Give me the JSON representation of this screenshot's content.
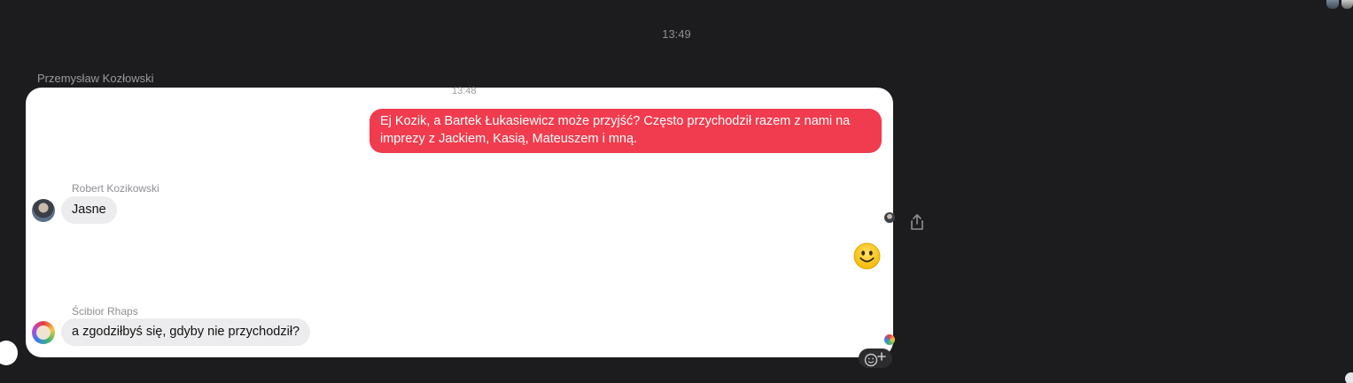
{
  "chat": {
    "top_timestamp": "13:49",
    "group_sender": "Przemysław Kozłowski",
    "group_timestamp": "13:48",
    "outgoing_message": "Ej Kozik, a Bartek Łukasiewicz może przyjść? Często przychodził razem z nami na imprezy z Jackiem, Kasią, Mateuszem i mną.",
    "messages": [
      {
        "sender": "Robert Kozikowski",
        "text": "Jasne",
        "avatar_icon": "avatar-robert"
      },
      {
        "sender": "Ścibior Rhaps",
        "text": "a zgodziłbyś się, gdyby nie przychodził?",
        "avatar_icon": "avatar-scibior"
      }
    ],
    "reaction_emoji": "smiley-face-emoji",
    "react_button_icon": "add-reaction-icon",
    "share_icon": "share-icon"
  },
  "colors": {
    "background": "#1c1c1e",
    "outgoing_bubble": "#f03c4e",
    "incoming_bubble": "#ececee",
    "card": "#ffffff"
  }
}
